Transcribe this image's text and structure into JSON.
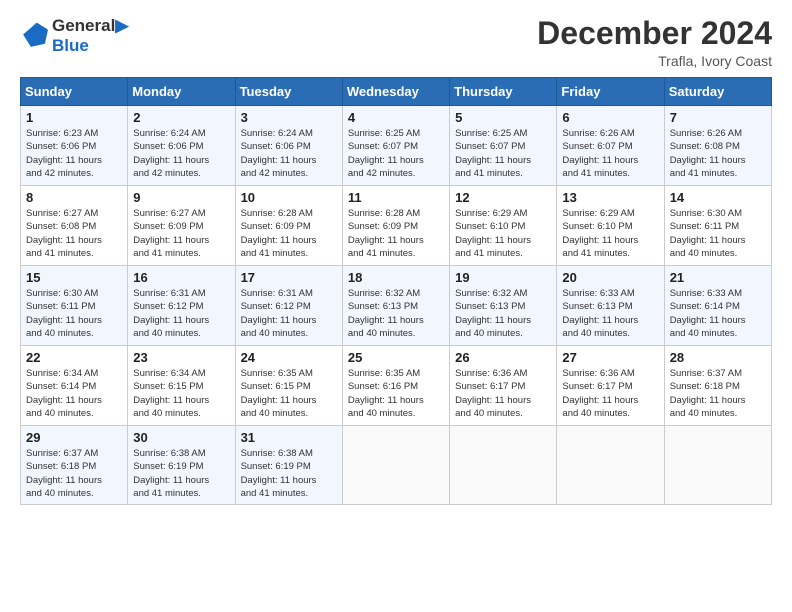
{
  "header": {
    "logo_line1": "General",
    "logo_line2": "Blue",
    "month": "December 2024",
    "location": "Trafla, Ivory Coast"
  },
  "days_of_week": [
    "Sunday",
    "Monday",
    "Tuesday",
    "Wednesday",
    "Thursday",
    "Friday",
    "Saturday"
  ],
  "weeks": [
    [
      {
        "day": "1",
        "info": "Sunrise: 6:23 AM\nSunset: 6:06 PM\nDaylight: 11 hours\nand 42 minutes."
      },
      {
        "day": "2",
        "info": "Sunrise: 6:24 AM\nSunset: 6:06 PM\nDaylight: 11 hours\nand 42 minutes."
      },
      {
        "day": "3",
        "info": "Sunrise: 6:24 AM\nSunset: 6:06 PM\nDaylight: 11 hours\nand 42 minutes."
      },
      {
        "day": "4",
        "info": "Sunrise: 6:25 AM\nSunset: 6:07 PM\nDaylight: 11 hours\nand 42 minutes."
      },
      {
        "day": "5",
        "info": "Sunrise: 6:25 AM\nSunset: 6:07 PM\nDaylight: 11 hours\nand 41 minutes."
      },
      {
        "day": "6",
        "info": "Sunrise: 6:26 AM\nSunset: 6:07 PM\nDaylight: 11 hours\nand 41 minutes."
      },
      {
        "day": "7",
        "info": "Sunrise: 6:26 AM\nSunset: 6:08 PM\nDaylight: 11 hours\nand 41 minutes."
      }
    ],
    [
      {
        "day": "8",
        "info": "Sunrise: 6:27 AM\nSunset: 6:08 PM\nDaylight: 11 hours\nand 41 minutes."
      },
      {
        "day": "9",
        "info": "Sunrise: 6:27 AM\nSunset: 6:09 PM\nDaylight: 11 hours\nand 41 minutes."
      },
      {
        "day": "10",
        "info": "Sunrise: 6:28 AM\nSunset: 6:09 PM\nDaylight: 11 hours\nand 41 minutes."
      },
      {
        "day": "11",
        "info": "Sunrise: 6:28 AM\nSunset: 6:09 PM\nDaylight: 11 hours\nand 41 minutes."
      },
      {
        "day": "12",
        "info": "Sunrise: 6:29 AM\nSunset: 6:10 PM\nDaylight: 11 hours\nand 41 minutes."
      },
      {
        "day": "13",
        "info": "Sunrise: 6:29 AM\nSunset: 6:10 PM\nDaylight: 11 hours\nand 41 minutes."
      },
      {
        "day": "14",
        "info": "Sunrise: 6:30 AM\nSunset: 6:11 PM\nDaylight: 11 hours\nand 40 minutes."
      }
    ],
    [
      {
        "day": "15",
        "info": "Sunrise: 6:30 AM\nSunset: 6:11 PM\nDaylight: 11 hours\nand 40 minutes."
      },
      {
        "day": "16",
        "info": "Sunrise: 6:31 AM\nSunset: 6:12 PM\nDaylight: 11 hours\nand 40 minutes."
      },
      {
        "day": "17",
        "info": "Sunrise: 6:31 AM\nSunset: 6:12 PM\nDaylight: 11 hours\nand 40 minutes."
      },
      {
        "day": "18",
        "info": "Sunrise: 6:32 AM\nSunset: 6:13 PM\nDaylight: 11 hours\nand 40 minutes."
      },
      {
        "day": "19",
        "info": "Sunrise: 6:32 AM\nSunset: 6:13 PM\nDaylight: 11 hours\nand 40 minutes."
      },
      {
        "day": "20",
        "info": "Sunrise: 6:33 AM\nSunset: 6:13 PM\nDaylight: 11 hours\nand 40 minutes."
      },
      {
        "day": "21",
        "info": "Sunrise: 6:33 AM\nSunset: 6:14 PM\nDaylight: 11 hours\nand 40 minutes."
      }
    ],
    [
      {
        "day": "22",
        "info": "Sunrise: 6:34 AM\nSunset: 6:14 PM\nDaylight: 11 hours\nand 40 minutes."
      },
      {
        "day": "23",
        "info": "Sunrise: 6:34 AM\nSunset: 6:15 PM\nDaylight: 11 hours\nand 40 minutes."
      },
      {
        "day": "24",
        "info": "Sunrise: 6:35 AM\nSunset: 6:15 PM\nDaylight: 11 hours\nand 40 minutes."
      },
      {
        "day": "25",
        "info": "Sunrise: 6:35 AM\nSunset: 6:16 PM\nDaylight: 11 hours\nand 40 minutes."
      },
      {
        "day": "26",
        "info": "Sunrise: 6:36 AM\nSunset: 6:17 PM\nDaylight: 11 hours\nand 40 minutes."
      },
      {
        "day": "27",
        "info": "Sunrise: 6:36 AM\nSunset: 6:17 PM\nDaylight: 11 hours\nand 40 minutes."
      },
      {
        "day": "28",
        "info": "Sunrise: 6:37 AM\nSunset: 6:18 PM\nDaylight: 11 hours\nand 40 minutes."
      }
    ],
    [
      {
        "day": "29",
        "info": "Sunrise: 6:37 AM\nSunset: 6:18 PM\nDaylight: 11 hours\nand 40 minutes."
      },
      {
        "day": "30",
        "info": "Sunrise: 6:38 AM\nSunset: 6:19 PM\nDaylight: 11 hours\nand 41 minutes."
      },
      {
        "day": "31",
        "info": "Sunrise: 6:38 AM\nSunset: 6:19 PM\nDaylight: 11 hours\nand 41 minutes."
      },
      {
        "day": "",
        "info": ""
      },
      {
        "day": "",
        "info": ""
      },
      {
        "day": "",
        "info": ""
      },
      {
        "day": "",
        "info": ""
      }
    ]
  ]
}
